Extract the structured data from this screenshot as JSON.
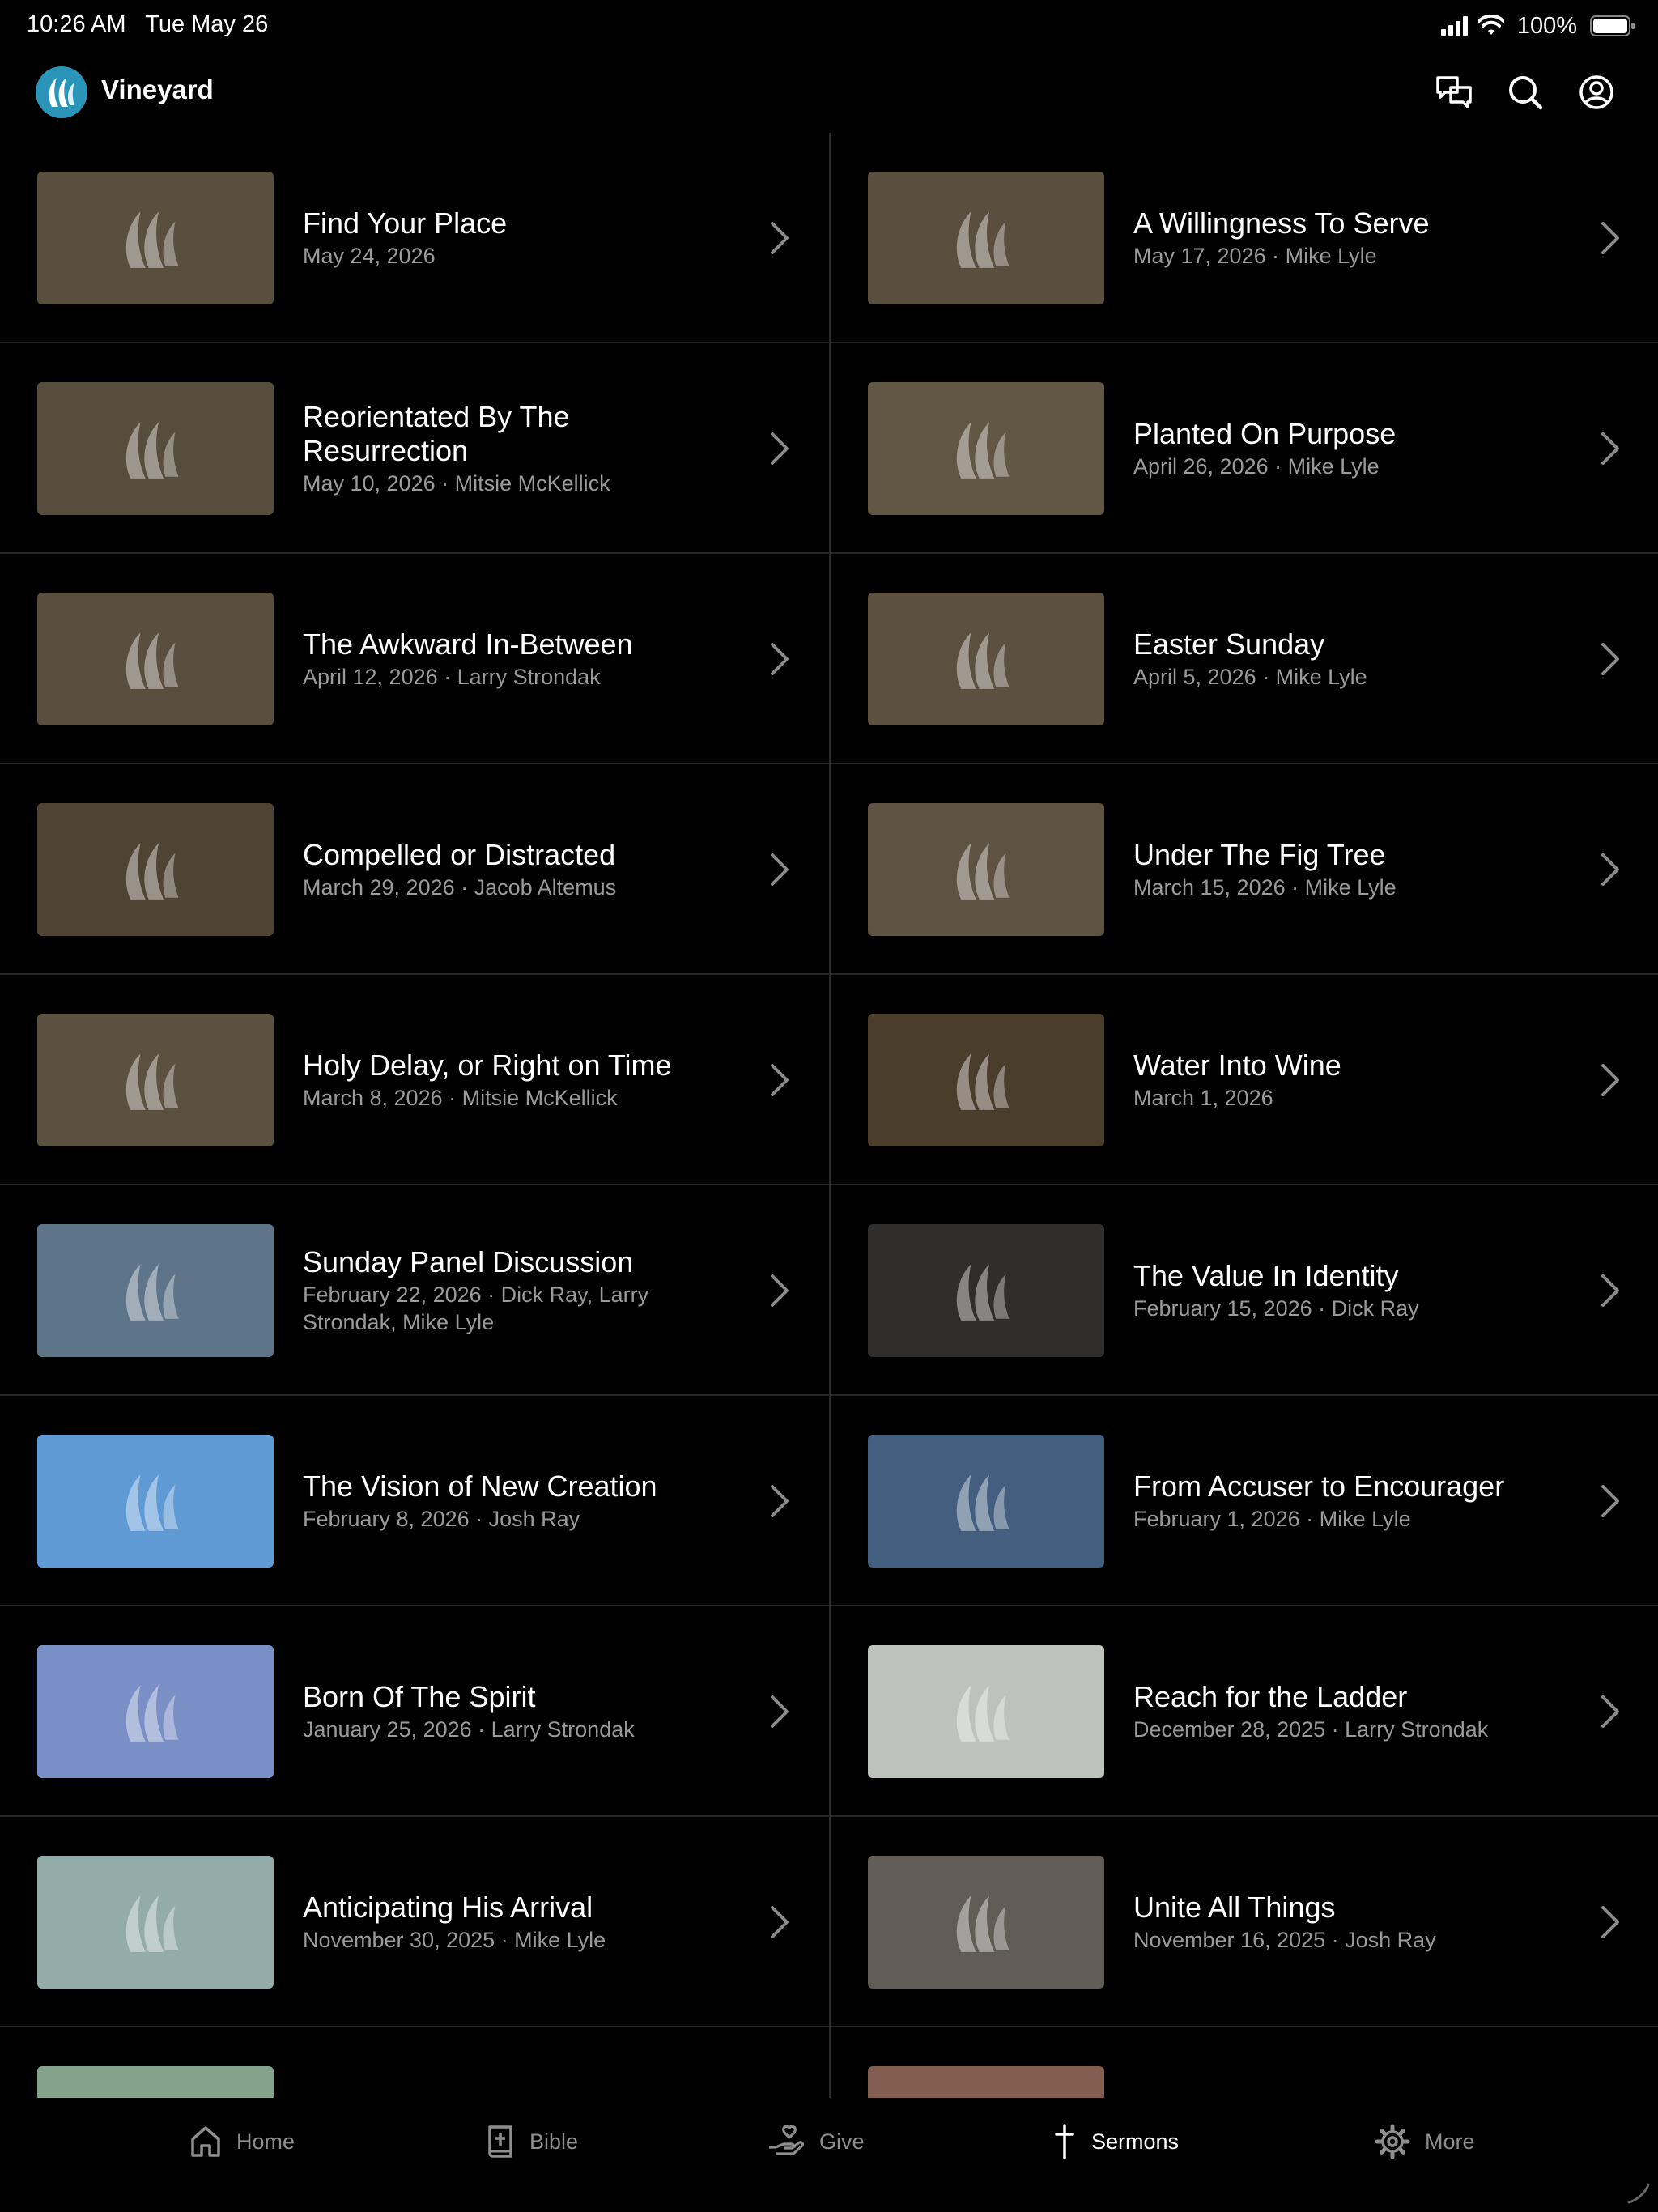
{
  "status_bar": {
    "time": "10:26 AM",
    "date": "Tue May 26",
    "battery": "100%"
  },
  "header": {
    "app_title": "Vineyard",
    "icons": [
      "chat-icon",
      "search-icon",
      "account-icon"
    ]
  },
  "sermons": [
    {
      "title": "Find Your Place",
      "meta": "May 24, 2026",
      "thumb_color": "#5a4f3f"
    },
    {
      "title": "A Willingness To Serve",
      "meta": "May 17, 2026 · Mike Lyle",
      "thumb_color": "#5a4e3e"
    },
    {
      "title": "Reorientated By The Resurrection",
      "meta": "May 10, 2026 · Mitsie McKellick",
      "thumb_color": "#574d3c"
    },
    {
      "title": "Planted On Purpose",
      "meta": "April 26, 2026 · Mike Lyle",
      "thumb_color": "#625645"
    },
    {
      "title": "The Awkward In-Between",
      "meta": "April 12, 2026 · Larry Strondak",
      "thumb_color": "#5a4f3f"
    },
    {
      "title": "Easter Sunday",
      "meta": "April 5, 2026 · Mike Lyle",
      "thumb_color": "#5c5040"
    },
    {
      "title": "Compelled or Distracted",
      "meta": "March 29, 2026 · Jacob Altemus",
      "thumb_color": "#4f4434"
    },
    {
      "title": "Under The Fig Tree",
      "meta": "March 15, 2026 · Mike Lyle",
      "thumb_color": "#5e5242"
    },
    {
      "title": "Holy Delay, or Right on Time",
      "meta": "March 8, 2026 · Mitsie McKellick",
      "thumb_color": "#5c5040"
    },
    {
      "title": "Water Into Wine",
      "meta": "March 1, 2026",
      "thumb_color": "#4a3d2c"
    },
    {
      "title": "Sunday Panel Discussion",
      "meta": "February 22, 2026 · Dick Ray, Larry Strondak, Mike Lyle",
      "thumb_color": "#5e7489"
    },
    {
      "title": "The Value In Identity",
      "meta": "February 15, 2026 · Dick Ray",
      "thumb_color": "#302e2c"
    },
    {
      "title": "The Vision of New Creation",
      "meta": "February 8, 2026 · Josh Ray",
      "thumb_color": "#609ad4"
    },
    {
      "title": "From Accuser to Encourager",
      "meta": "February 1, 2026 · Mike Lyle",
      "thumb_color": "#435e7e"
    },
    {
      "title": "Born Of The Spirit",
      "meta": "January 25, 2026 · Larry Strondak",
      "thumb_color": "#7a8fc6"
    },
    {
      "title": "Reach for the Ladder",
      "meta": "December 28, 2025 · Larry Strondak",
      "thumb_color": "#bdc2bc"
    },
    {
      "title": "Anticipating His Arrival",
      "meta": "November 30, 2025 · Mike Lyle",
      "thumb_color": "#93acaa"
    },
    {
      "title": "Unite All Things",
      "meta": "November 16, 2025 · Josh Ray",
      "thumb_color": "#625c56"
    },
    {
      "title": "",
      "meta": "",
      "thumb_color": "#83a48b"
    },
    {
      "title": "",
      "meta": "",
      "thumb_color": "#835d50"
    }
  ],
  "tab_bar": {
    "tabs": [
      {
        "label": "Home",
        "icon": "home-icon",
        "active": false
      },
      {
        "label": "Bible",
        "icon": "bible-icon",
        "active": false
      },
      {
        "label": "Give",
        "icon": "give-icon",
        "active": false
      },
      {
        "label": "Sermons",
        "icon": "cross-icon",
        "active": true
      },
      {
        "label": "More",
        "icon": "gear-icon",
        "active": false
      }
    ]
  },
  "colors": {
    "background": "#000000",
    "divider": "#262626",
    "meta_text": "#9a9a9a",
    "logo": "#2a95b8"
  }
}
